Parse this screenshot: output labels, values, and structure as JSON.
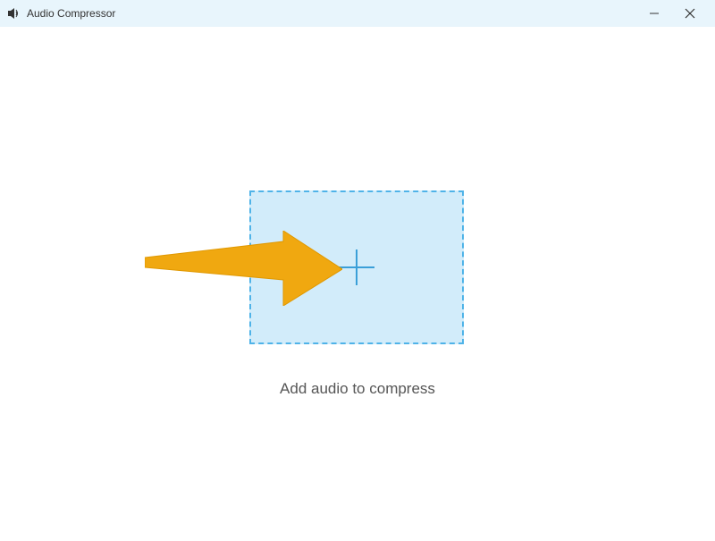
{
  "titlebar": {
    "app_title": "Audio Compressor"
  },
  "main": {
    "instruction": "Add audio to compress"
  },
  "colors": {
    "titlebar_bg": "#e8f5fc",
    "dropzone_bg": "#d2ecfa",
    "dropzone_border": "#4fb3e8",
    "plus_color": "#3a9fd8",
    "arrow_fill": "#f0a810",
    "arrow_stroke": "#e09800"
  }
}
